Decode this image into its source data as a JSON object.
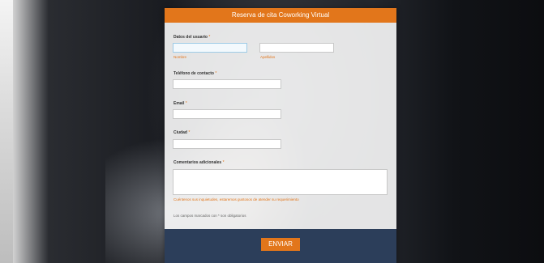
{
  "form": {
    "title": "Reserva de cita Coworking Virtual",
    "user_data_label": "Datos del usuario",
    "required_mark": "*",
    "first_name_value": "",
    "first_name_sublabel": "Nombre",
    "last_name_value": "",
    "last_name_sublabel": "Apellidos",
    "phone_label": "Teléfono de contacto",
    "phone_value": "",
    "email_label": "Email",
    "email_value": "",
    "city_label": "Ciudad",
    "city_value": "",
    "comments_label": "Comentarios adicionales",
    "comments_value": "",
    "comments_hint": "Cuéntenos sus inquietudes, estaremos gustosos de atender su requerimiento",
    "required_note": "Los campos marcados con * son obligatorios",
    "submit_label": "ENVIAR"
  },
  "colors": {
    "accent": "#e2761b",
    "footer": "#2c3e5a"
  }
}
